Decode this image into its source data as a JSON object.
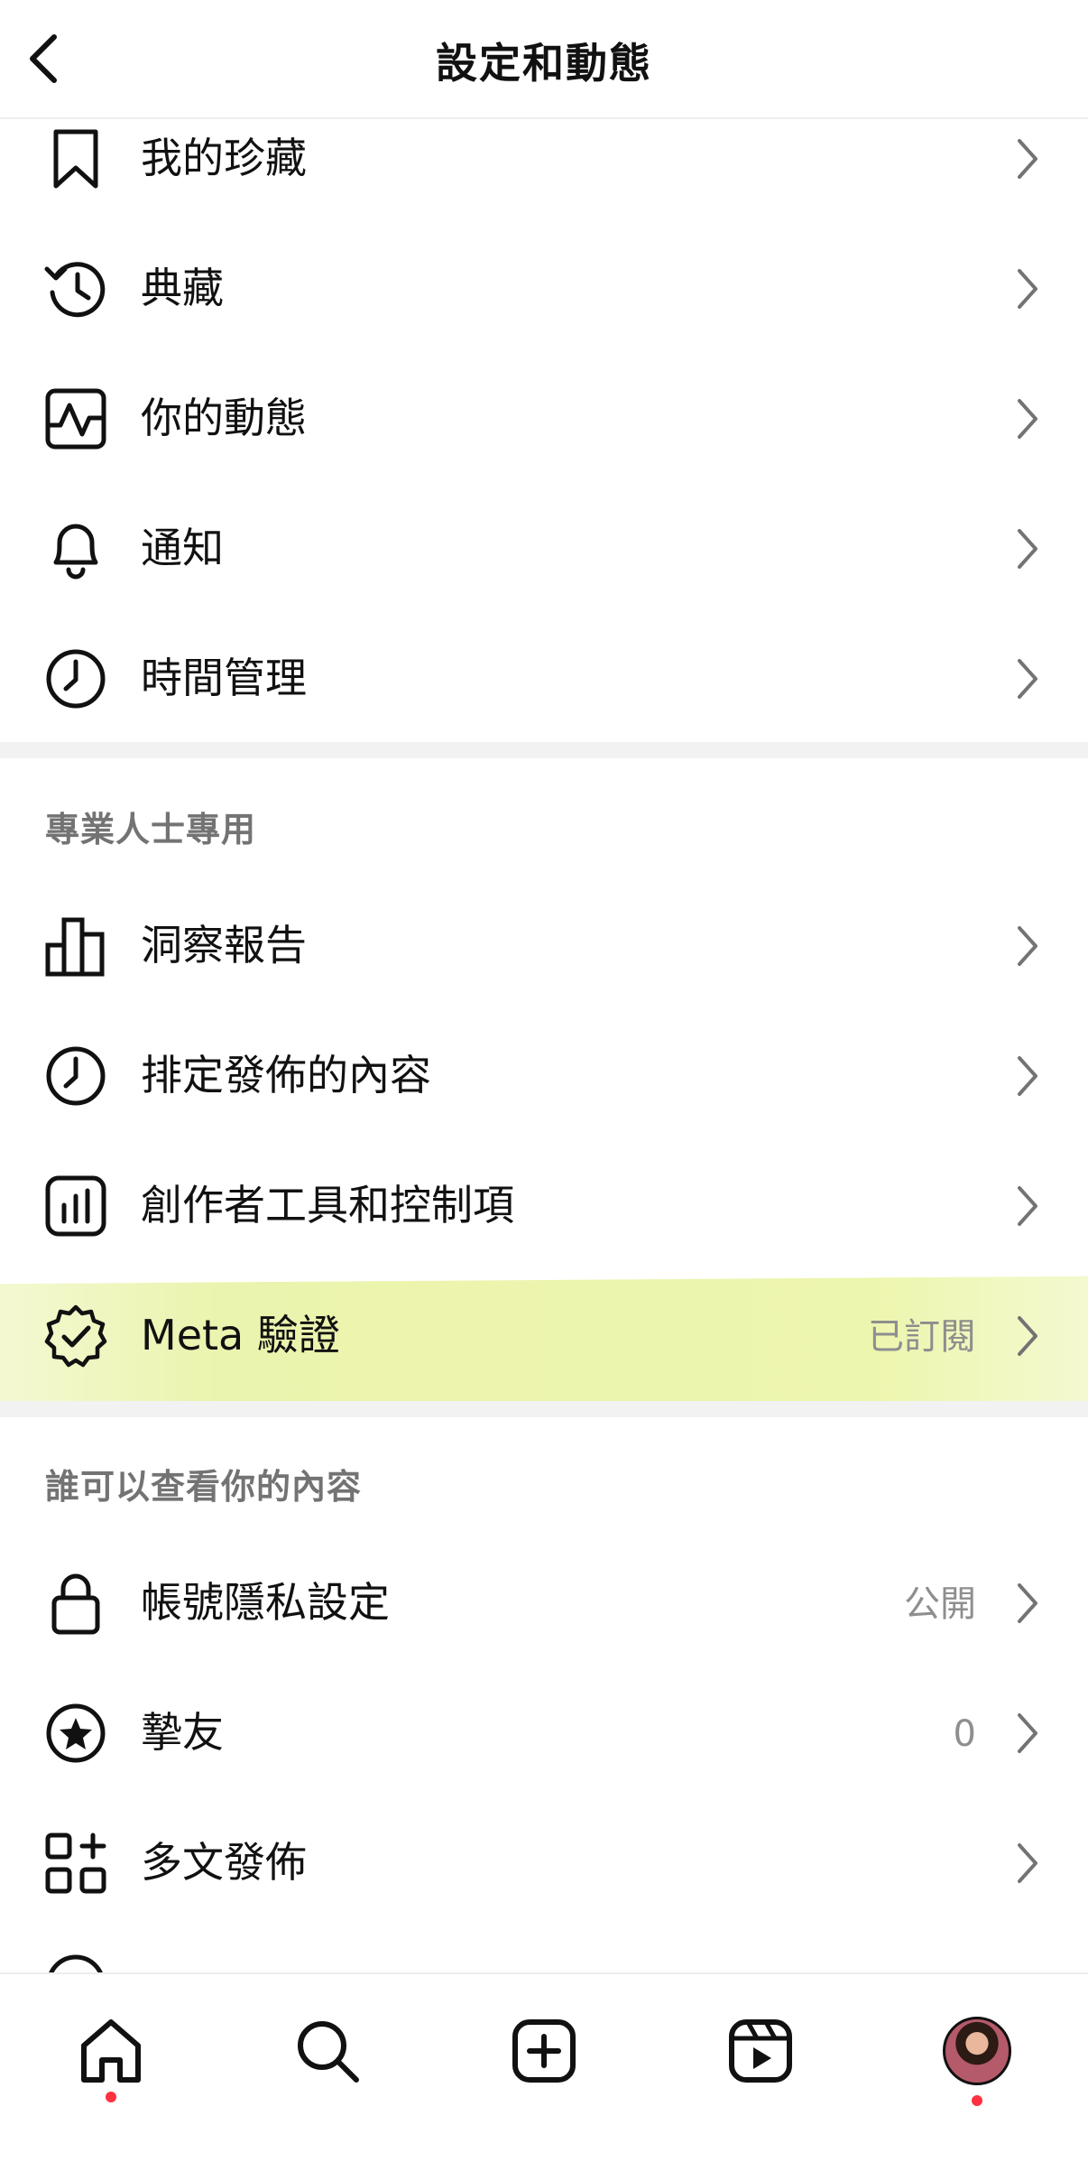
{
  "header": {
    "title": "設定和動態"
  },
  "section1": {
    "items": [
      {
        "label": "我的珍藏",
        "icon": "bookmark-icon"
      },
      {
        "label": "典藏",
        "icon": "archive-history-icon"
      },
      {
        "label": "你的動態",
        "icon": "activity-icon"
      },
      {
        "label": "通知",
        "icon": "bell-icon"
      },
      {
        "label": "時間管理",
        "icon": "clock-icon"
      }
    ]
  },
  "section2": {
    "title": "專業人士專用",
    "items": [
      {
        "label": "洞察報告",
        "icon": "insights-chart-icon"
      },
      {
        "label": "排定發佈的內容",
        "icon": "clock-icon"
      },
      {
        "label": "創作者工具和控制項",
        "icon": "creator-tools-icon"
      },
      {
        "label": "Meta 驗證",
        "value": "已訂閱",
        "icon": "verified-badge-icon"
      }
    ]
  },
  "section3": {
    "title": "誰可以查看你的內容",
    "items": [
      {
        "label": "帳號隱私設定",
        "value": "公開",
        "icon": "lock-icon"
      },
      {
        "label": "摯友",
        "value": "0",
        "icon": "close-friends-star-icon"
      },
      {
        "label": "多文發佈",
        "icon": "crossposting-icon"
      }
    ]
  },
  "bottom_nav": {
    "items": [
      {
        "name": "home",
        "icon": "home-icon",
        "has_dot": true
      },
      {
        "name": "search",
        "icon": "search-icon",
        "has_dot": false
      },
      {
        "name": "create",
        "icon": "add-post-icon",
        "has_dot": false
      },
      {
        "name": "reels",
        "icon": "reels-icon",
        "has_dot": false
      },
      {
        "name": "profile",
        "icon": "profile-avatar",
        "has_dot": true
      }
    ]
  },
  "colors": {
    "highlight": "#eef5b0",
    "notification_dot": "#ff3040",
    "secondary_text": "#8e8e8e"
  }
}
